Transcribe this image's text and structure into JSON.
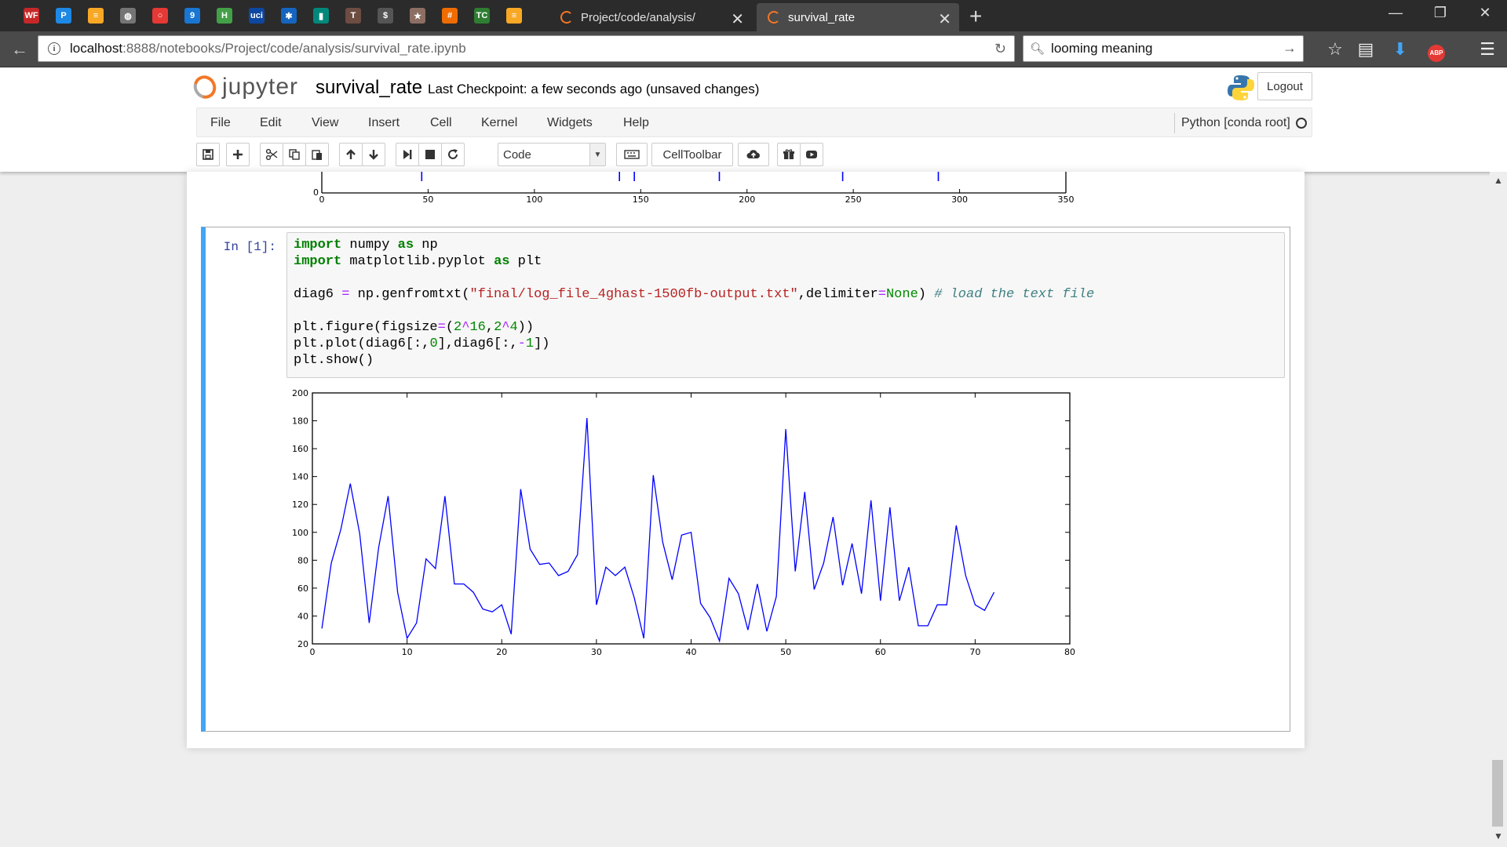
{
  "browser": {
    "pinned_tabs": [
      {
        "icon": "wf-icon",
        "glyph": "WF",
        "color": "#c62828"
      },
      {
        "icon": "p-icon",
        "glyph": "P",
        "color": "#1e88e5"
      },
      {
        "icon": "feed-icon",
        "glyph": "≡",
        "color": "#f9a825"
      },
      {
        "icon": "globe-icon",
        "glyph": "◍",
        "color": "#757575"
      },
      {
        "icon": "circle-icon",
        "glyph": "○",
        "color": "#e53935"
      },
      {
        "icon": "calendar-icon",
        "glyph": "9",
        "color": "#1976d2"
      },
      {
        "icon": "h-icon",
        "glyph": "H",
        "color": "#43a047"
      },
      {
        "icon": "uci-icon",
        "glyph": "uci",
        "color": "#0d47a1"
      },
      {
        "icon": "star-icon",
        "glyph": "✱",
        "color": "#1565c0"
      },
      {
        "icon": "book-icon",
        "glyph": "▮",
        "color": "#00897b"
      },
      {
        "icon": "t-icon",
        "glyph": "T",
        "color": "#6d4c41"
      },
      {
        "icon": "dollar-icon",
        "glyph": "$",
        "color": "#555555"
      },
      {
        "icon": "leaf-icon",
        "glyph": "★",
        "color": "#8d6e63"
      },
      {
        "icon": "hash-icon",
        "glyph": "#",
        "color": "#ef6c00"
      },
      {
        "icon": "tc-icon",
        "glyph": "TC",
        "color": "#2e7d32"
      },
      {
        "icon": "feed2-icon",
        "glyph": "≡",
        "color": "#f9a825"
      }
    ],
    "tabs": [
      {
        "title": "Project/code/analysis/",
        "active": false
      },
      {
        "title": "survival_rate",
        "active": true
      }
    ],
    "url_host": "localhost",
    "url_path": ":8888/notebooks/Project/code/analysis/survival_rate.ipynb",
    "search_value": "looming meaning"
  },
  "jupyter": {
    "logo_text": "jupyter",
    "notebook_name": "survival_rate",
    "checkpoint": "Last Checkpoint: a few seconds ago (unsaved changes)",
    "logout_label": "Logout",
    "menu": [
      "File",
      "Edit",
      "View",
      "Insert",
      "Cell",
      "Kernel",
      "Widgets",
      "Help"
    ],
    "kernel_name": "Python [conda root]",
    "cell_type": "Code",
    "celltoolbar_label": "CellToolbar"
  },
  "cell": {
    "prompt": "In [1]:"
  },
  "prev_chart": {
    "chart_data": {
      "type": "line",
      "xlim": [
        0,
        350
      ],
      "ylim_visible_bottom": 0,
      "x_ticks": [
        0,
        50,
        100,
        150,
        200,
        250,
        300,
        350
      ],
      "y_ticks_visible": [
        0
      ],
      "color": "#0000ff",
      "spikes_x": [
        47,
        140,
        147,
        187,
        245,
        290
      ]
    }
  },
  "chart_data": {
    "type": "line",
    "title": "",
    "xlabel": "",
    "ylabel": "",
    "xlim": [
      0,
      80
    ],
    "ylim": [
      20,
      200
    ],
    "x_ticks": [
      0,
      10,
      20,
      30,
      40,
      50,
      60,
      70,
      80
    ],
    "y_ticks": [
      20,
      40,
      60,
      80,
      100,
      120,
      140,
      160,
      180,
      200
    ],
    "grid": false,
    "color": "#0000ff",
    "x": [
      1,
      2,
      3,
      4,
      5,
      6,
      7,
      8,
      9,
      10,
      11,
      12,
      13,
      14,
      15,
      16,
      17,
      18,
      19,
      20,
      21,
      22,
      23,
      24,
      25,
      26,
      27,
      28,
      29,
      30,
      31,
      32,
      33,
      34,
      35,
      36,
      37,
      38,
      39,
      40,
      41,
      42,
      43,
      44,
      45,
      46,
      47,
      48,
      49,
      50,
      51,
      52,
      53,
      54,
      55,
      56,
      57,
      58,
      59,
      60,
      61,
      62,
      63,
      64,
      65,
      66,
      67,
      68,
      69,
      70,
      71,
      72
    ],
    "y": [
      31,
      78,
      102,
      135,
      99,
      35,
      89,
      126,
      57,
      24,
      35,
      81,
      74,
      126,
      63,
      63,
      57,
      45,
      43,
      48,
      27,
      131,
      88,
      77,
      78,
      69,
      72,
      84,
      182,
      48,
      75,
      69,
      75,
      53,
      24,
      141,
      93,
      66,
      98,
      100,
      49,
      39,
      22,
      67,
      56,
      30,
      63,
      29,
      54,
      174,
      72,
      129,
      59,
      78,
      111,
      62,
      92,
      56,
      123,
      51,
      118,
      51,
      75,
      33,
      33,
      48,
      48,
      105,
      69,
      48,
      44,
      57
    ]
  }
}
